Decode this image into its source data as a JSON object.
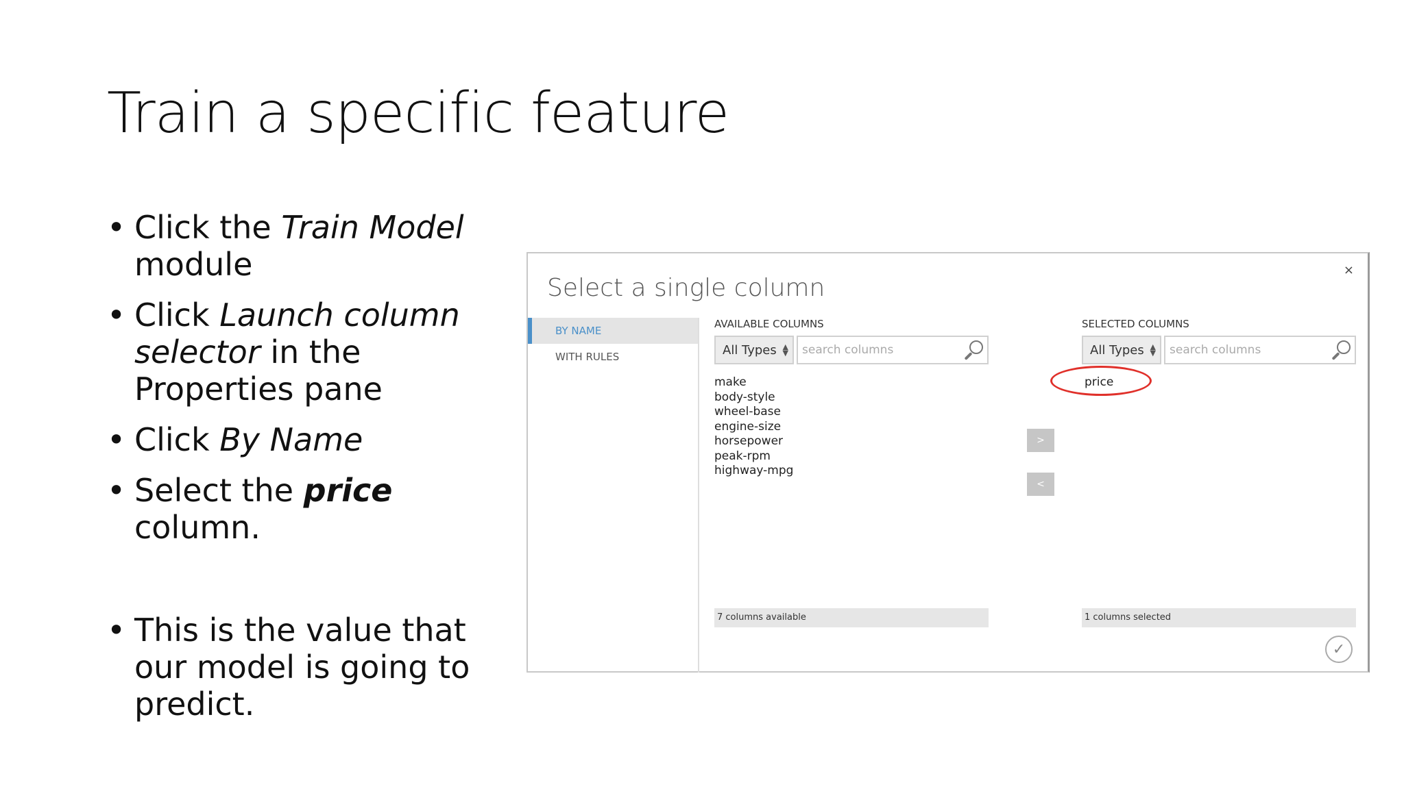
{
  "slide": {
    "title": "Train a specific feature",
    "bullets": [
      {
        "pre": "Click the ",
        "em": "Train Model",
        "post": " module"
      },
      {
        "pre": "Click ",
        "em": "Launch column selector",
        "post": " in the Properties pane"
      },
      {
        "pre": "Click ",
        "em": "By Name",
        "post": ""
      },
      {
        "pre": "Select the ",
        "strong": "price",
        "post": " column."
      },
      {
        "text": "This is the value that our model is going to predict."
      }
    ]
  },
  "dialog": {
    "title": "Select a single column",
    "close_label": "×",
    "sidebar": [
      {
        "label": "BY NAME",
        "active": true
      },
      {
        "label": "WITH RULES",
        "active": false
      }
    ],
    "available": {
      "header": "AVAILABLE COLUMNS",
      "type_filter": "All Types",
      "search_placeholder": "search columns",
      "columns": [
        "make",
        "body-style",
        "wheel-base",
        "engine-size",
        "horsepower",
        "peak-rpm",
        "highway-mpg"
      ],
      "footer": "7 columns available"
    },
    "selected": {
      "header": "SELECTED COLUMNS",
      "type_filter": "All Types",
      "search_placeholder": "search columns",
      "columns": [
        "price"
      ],
      "footer": "1 columns selected"
    },
    "add_label": ">",
    "remove_label": "<",
    "ok_label": "✓",
    "highlight_color": "#e0302a",
    "accent_color": "#4a90c9"
  }
}
